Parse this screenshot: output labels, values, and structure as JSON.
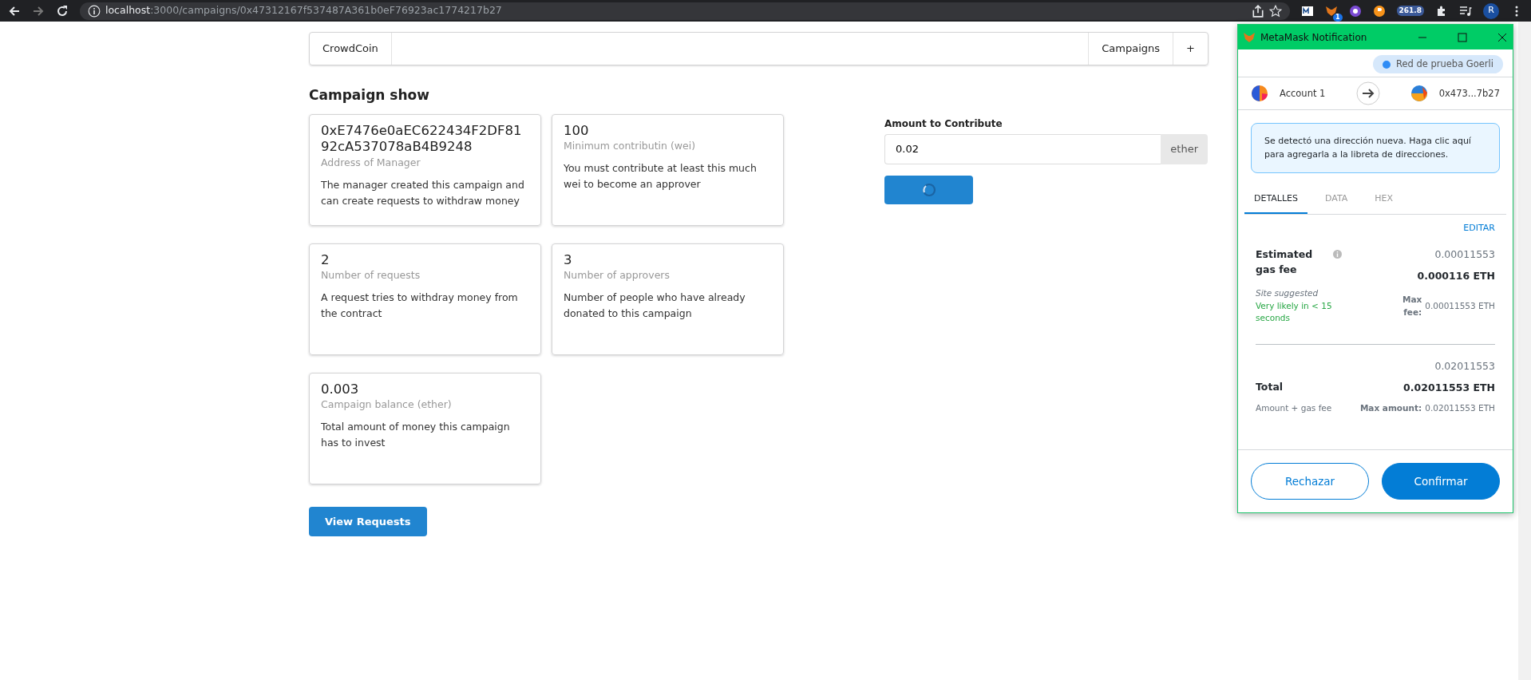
{
  "browser": {
    "url_host": "localhost",
    "url_path": ":3000/campaigns/0x47312167f537487A361b0eF76923ac1774217b27",
    "extension_badge": "1",
    "extension_counter": "261.8",
    "profile_initial": "R"
  },
  "menu": {
    "brand": "CrowdCoin",
    "items": [
      "Campaigns",
      "+"
    ]
  },
  "heading": "Campaign show",
  "cards": [
    {
      "header": "0xE7476e0aEC622434F2DF8192cA537078aB4B9248",
      "meta": "Address of Manager",
      "description": "The manager created this campaign and can create requests to withdraw money"
    },
    {
      "header": "100",
      "meta": "Minimum contributin (wei)",
      "description": "You must contribute at least this much wei to become an approver"
    },
    {
      "header": "2",
      "meta": "Number of requests",
      "description": "A request tries to withdray money from the contract"
    },
    {
      "header": "3",
      "meta": "Number of approvers",
      "description": "Number of people who have already donated to this campaign"
    },
    {
      "header": "0.003",
      "meta": "Campaign balance (ether)",
      "description": "Total amount of money this campaign has to invest"
    }
  ],
  "view_requests_button": "View Requests",
  "contribute_form": {
    "label": "Amount to Contribute",
    "value": "0.02",
    "unit": "ether",
    "loading": true
  },
  "metamask": {
    "title": "MetaMask Notification",
    "network": "Red de prueba Goerli",
    "from_account": "Account 1",
    "to_address": "0x473...7b27",
    "notice": "Se detectó una dirección nueva. Haga clic aquí para agregarla a la libreta de direcciones.",
    "tabs": [
      {
        "label": "DETALLES",
        "selected": true
      },
      {
        "label": "DATA",
        "selected": false
      },
      {
        "label": "HEX",
        "selected": false
      }
    ],
    "edit_link": "EDITAR",
    "gas": {
      "label": "Estimated gas fee",
      "secondary": "0.00011553",
      "primary": "0.000116 ETH",
      "site_suggested": "Site suggested",
      "likelihood": "Very likely in < 15 seconds",
      "max_label": "Max fee:",
      "max_value": "0.00011553 ETH"
    },
    "total": {
      "label": "Total",
      "secondary": "0.02011553",
      "primary": "0.02011553 ETH",
      "sub": "Amount + gas fee",
      "max_label": "Max amount:",
      "max_value": "0.02011553 ETH"
    },
    "buttons": [
      "Rechazar",
      "Confirmar"
    ]
  }
}
